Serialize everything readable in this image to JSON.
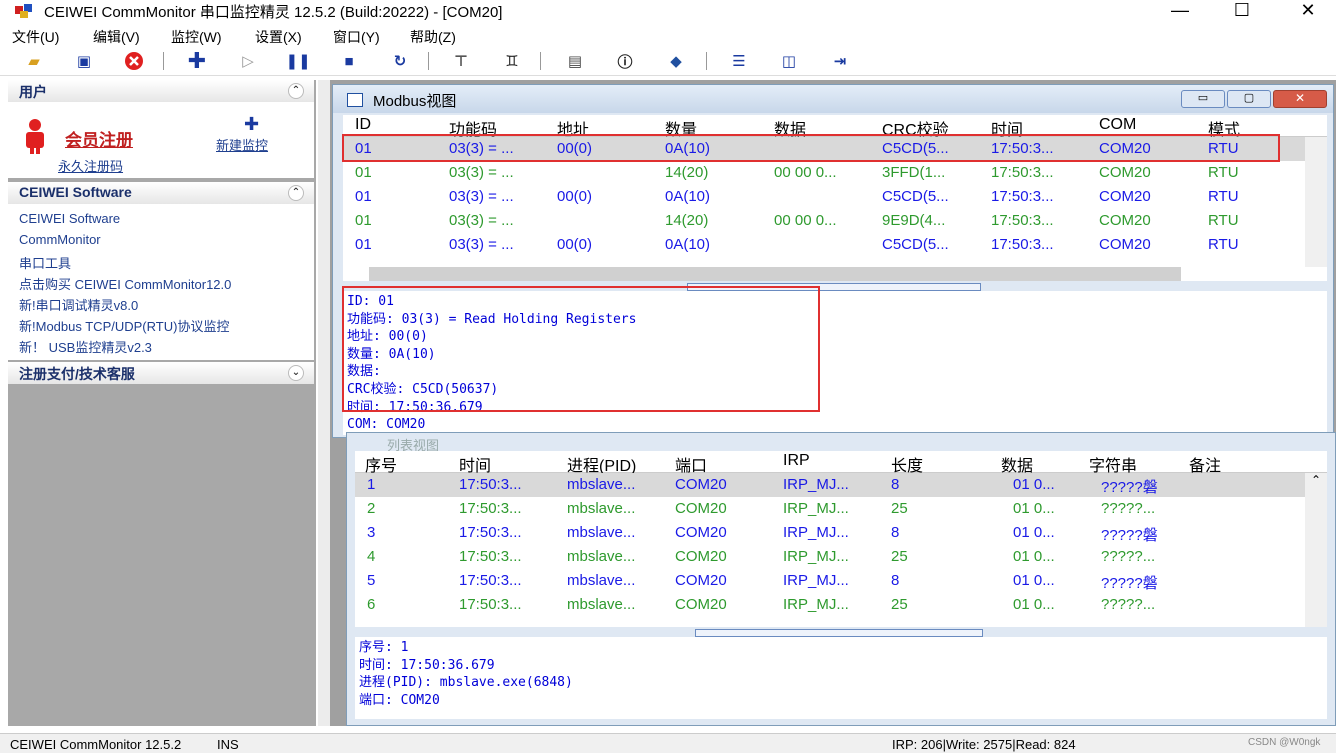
{
  "window": {
    "title": "CEIWEI CommMonitor 串口监控精灵 12.5.2 (Build:20222) - [COM20]",
    "minimize": "—",
    "maximize": "☐",
    "close": "✕"
  },
  "menu": [
    "文件(U)",
    "编辑(V)",
    "监控(W)",
    "设置(X)",
    "窗口(Y)",
    "帮助(Z)"
  ],
  "sidebar": {
    "user_panel": {
      "title": "用户",
      "register": "会员注册",
      "permanent_code": "永久注册码",
      "new_monitor": "新建监控"
    },
    "software_panel": {
      "title": "CEIWEI Software",
      "items": [
        "CEIWEI Software",
        "CommMonitor",
        "串口工具",
        "点击购买 CEIWEI CommMonitor12.0",
        "新!串口调试精灵v8.0",
        "新!Modbus TCP/UDP(RTU)协议监控",
        "新！ USB监控精灵v2.3"
      ]
    },
    "support_panel": {
      "title": "注册支付/技术客服"
    }
  },
  "modbus": {
    "title": "Modbus视图",
    "columns": [
      "ID",
      "功能码",
      "地址",
      "数量",
      "数据",
      "CRC校验",
      "时间",
      "COM",
      "模式"
    ],
    "rows": [
      [
        "01",
        "03(3) = ...",
        "00(0)",
        "0A(10)",
        "",
        "C5CD(5...",
        "17:50:3...",
        "COM20",
        "RTU"
      ],
      [
        "01",
        "03(3) = ...",
        "",
        "14(20)",
        "00 00 0...",
        "3FFD(1...",
        "17:50:3...",
        "COM20",
        "RTU"
      ],
      [
        "01",
        "03(3) = ...",
        "00(0)",
        "0A(10)",
        "",
        "C5CD(5...",
        "17:50:3...",
        "COM20",
        "RTU"
      ],
      [
        "01",
        "03(3) = ...",
        "",
        "14(20)",
        "00 00 0...",
        "9E9D(4...",
        "17:50:3...",
        "COM20",
        "RTU"
      ],
      [
        "01",
        "03(3) = ...",
        "00(0)",
        "0A(10)",
        "",
        "C5CD(5...",
        "17:50:3...",
        "COM20",
        "RTU"
      ]
    ],
    "detail": [
      "ID: 01",
      "功能码: 03(3) = Read Holding Registers",
      "地址: 00(0)",
      "数量: 0A(10)",
      "数据:",
      "CRC校验: C5CD(50637)",
      "时间: 17:50:36.679",
      "COM: COM20"
    ]
  },
  "list": {
    "title": "列表视图",
    "columns": [
      "序号",
      "时间",
      "进程(PID)",
      "端口",
      "IRP",
      "长度",
      "数据",
      "字符串",
      "备注"
    ],
    "rows": [
      [
        "1",
        "17:50:3...",
        "mbslave...",
        "COM20",
        "IRP_MJ...",
        "8",
        "01 0...",
        "?????磐",
        ""
      ],
      [
        "2",
        "17:50:3...",
        "mbslave...",
        "COM20",
        "IRP_MJ...",
        "25",
        "01 0...",
        "?????...",
        ""
      ],
      [
        "3",
        "17:50:3...",
        "mbslave...",
        "COM20",
        "IRP_MJ...",
        "8",
        "01 0...",
        "?????磐",
        ""
      ],
      [
        "4",
        "17:50:3...",
        "mbslave...",
        "COM20",
        "IRP_MJ...",
        "25",
        "01 0...",
        "?????...",
        ""
      ],
      [
        "5",
        "17:50:3...",
        "mbslave...",
        "COM20",
        "IRP_MJ...",
        "8",
        "01 0...",
        "?????磐",
        ""
      ],
      [
        "6",
        "17:50:3...",
        "mbslave...",
        "COM20",
        "IRP_MJ...",
        "25",
        "01 0...",
        "?????...",
        ""
      ]
    ],
    "detail": [
      "序号: 1",
      "时间: 17:50:36.679",
      "进程(PID): mbslave.exe(6848)",
      "端口: COM20"
    ]
  },
  "status": {
    "app": "CEIWEI CommMonitor 12.5.2",
    "mode": "INS",
    "counters": "IRP: 206|Write: 2575|Read: 824",
    "watermark": "CSDN @W0ngk"
  },
  "colors": {
    "blue_row": "#1a1ae6",
    "green_row": "#2e9a2e",
    "red_highlight": "#e03030",
    "detail_text": "#0000d8"
  }
}
